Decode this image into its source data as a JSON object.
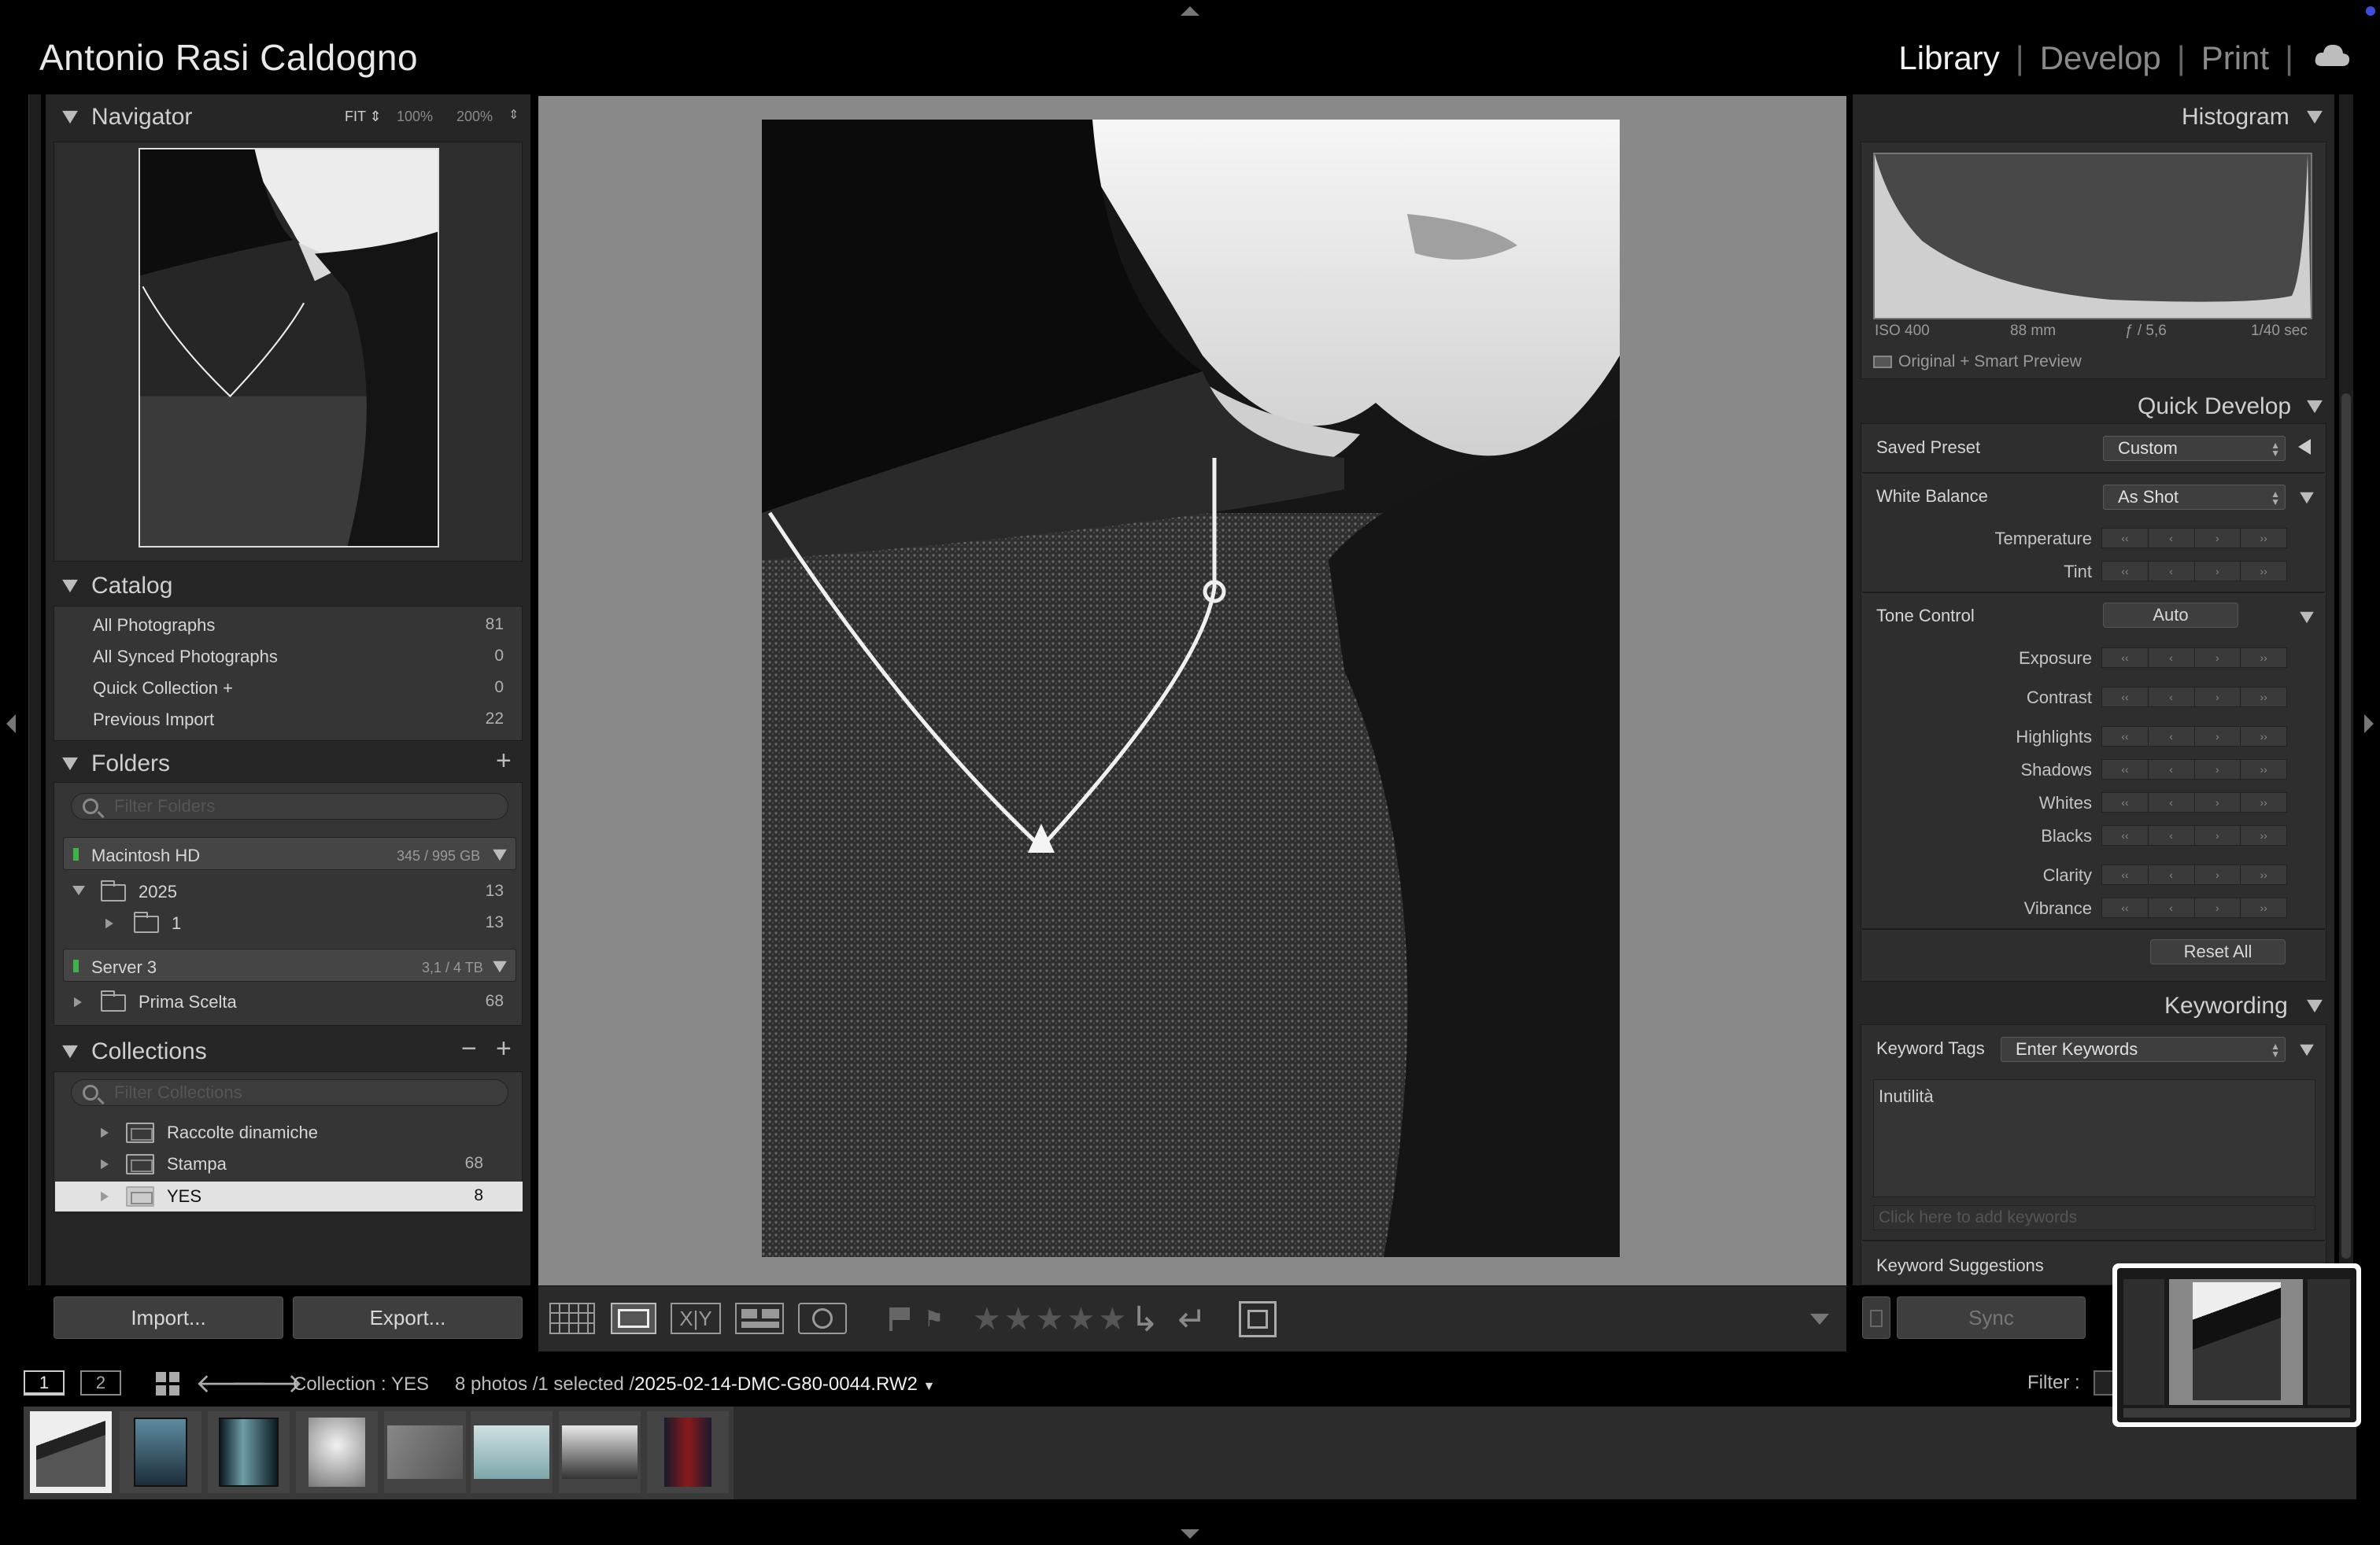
{
  "identity": {
    "name": "Antonio Rasi Caldogno"
  },
  "modules": {
    "items": [
      "Library",
      "Develop",
      "Print"
    ],
    "active": "Library"
  },
  "navigator": {
    "title": "Navigator",
    "zoom": [
      "FIT",
      "100%",
      "200%"
    ]
  },
  "catalog": {
    "title": "Catalog",
    "items": [
      {
        "label": "All Photographs",
        "count": "81"
      },
      {
        "label": "All Synced Photographs",
        "count": "0"
      },
      {
        "label": "Quick Collection +",
        "count": "0"
      },
      {
        "label": "Previous Import",
        "count": "22"
      }
    ]
  },
  "folders": {
    "title": "Folders",
    "plus": "+",
    "filter_placeholder": "Filter Folders",
    "volume1": {
      "name": "Macintosh HD",
      "size": "345 / 995 GB"
    },
    "folder2025": {
      "name": "2025",
      "count": "13"
    },
    "folder1": {
      "name": "1",
      "count": "13"
    },
    "volume2": {
      "name": "Server 3",
      "size": "3,1 / 4 TB"
    },
    "prima": {
      "name": "Prima Scelta",
      "count": "68"
    }
  },
  "collections": {
    "title": "Collections",
    "minus": "−",
    "plus": "+",
    "filter_placeholder": "Filter Collections",
    "items": [
      {
        "label": "Raccolte dinamiche",
        "count": ""
      },
      {
        "label": "Stampa",
        "count": "68"
      },
      {
        "label": "YES",
        "count": "8"
      }
    ]
  },
  "buttons": {
    "import": "Import...",
    "export": "Export...",
    "sync": "Sync",
    "reset_all": "Reset All",
    "auto": "Auto"
  },
  "histogram": {
    "title": "Histogram",
    "iso": "ISO 400",
    "focal": "88 mm",
    "aperture": "ƒ / 5,6",
    "shutter": "1/40 sec",
    "preview": "Original + Smart Preview"
  },
  "quick_develop": {
    "title": "Quick Develop",
    "saved_preset": {
      "label": "Saved Preset",
      "value": "Custom"
    },
    "white_balance": {
      "label": "White Balance",
      "value": "As Shot"
    },
    "temperature": "Temperature",
    "tint": "Tint",
    "tone_control": "Tone Control",
    "tone_rows": [
      "Exposure",
      "Contrast",
      "Highlights",
      "Shadows",
      "Whites",
      "Blacks",
      "Clarity",
      "Vibrance"
    ]
  },
  "keywording": {
    "title": "Keywording",
    "tags_label": "Keyword Tags",
    "tags_value": "Enter Keywords",
    "keywords": "Inutilità",
    "add_placeholder": "Click here to add keywords",
    "suggestions": "Keyword Suggestions"
  },
  "toolbar": {
    "stars": "★★★★★"
  },
  "filmstrip": {
    "page1": "1",
    "page2": "2",
    "source": "Collection : YES",
    "count_text": "8 photos /1 selected /",
    "filename": "2025-02-14-DMC-G80-0044.RW2",
    "filter": "Filter :"
  },
  "xy_label": "X|Y"
}
